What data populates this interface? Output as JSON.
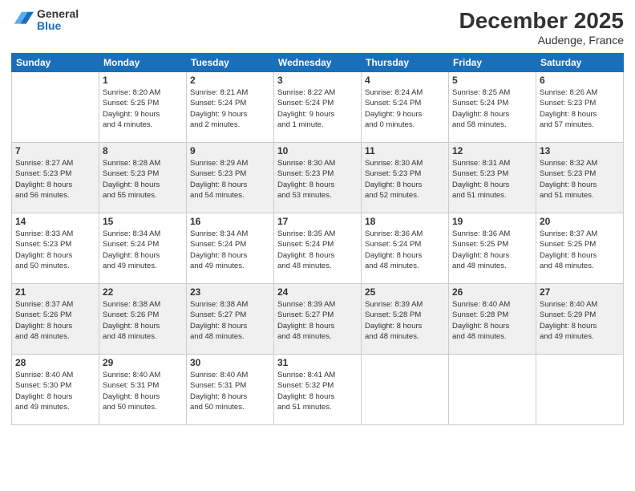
{
  "header": {
    "logo_general": "General",
    "logo_blue": "Blue",
    "month_title": "December 2025",
    "location": "Audenge, France"
  },
  "days_of_week": [
    "Sunday",
    "Monday",
    "Tuesday",
    "Wednesday",
    "Thursday",
    "Friday",
    "Saturday"
  ],
  "weeks": [
    [
      {
        "day": "",
        "info": ""
      },
      {
        "day": "1",
        "info": "Sunrise: 8:20 AM\nSunset: 5:25 PM\nDaylight: 9 hours\nand 4 minutes."
      },
      {
        "day": "2",
        "info": "Sunrise: 8:21 AM\nSunset: 5:24 PM\nDaylight: 9 hours\nand 2 minutes."
      },
      {
        "day": "3",
        "info": "Sunrise: 8:22 AM\nSunset: 5:24 PM\nDaylight: 9 hours\nand 1 minute."
      },
      {
        "day": "4",
        "info": "Sunrise: 8:24 AM\nSunset: 5:24 PM\nDaylight: 9 hours\nand 0 minutes."
      },
      {
        "day": "5",
        "info": "Sunrise: 8:25 AM\nSunset: 5:24 PM\nDaylight: 8 hours\nand 58 minutes."
      },
      {
        "day": "6",
        "info": "Sunrise: 8:26 AM\nSunset: 5:23 PM\nDaylight: 8 hours\nand 57 minutes."
      }
    ],
    [
      {
        "day": "7",
        "info": "Sunrise: 8:27 AM\nSunset: 5:23 PM\nDaylight: 8 hours\nand 56 minutes."
      },
      {
        "day": "8",
        "info": "Sunrise: 8:28 AM\nSunset: 5:23 PM\nDaylight: 8 hours\nand 55 minutes."
      },
      {
        "day": "9",
        "info": "Sunrise: 8:29 AM\nSunset: 5:23 PM\nDaylight: 8 hours\nand 54 minutes."
      },
      {
        "day": "10",
        "info": "Sunrise: 8:30 AM\nSunset: 5:23 PM\nDaylight: 8 hours\nand 53 minutes."
      },
      {
        "day": "11",
        "info": "Sunrise: 8:30 AM\nSunset: 5:23 PM\nDaylight: 8 hours\nand 52 minutes."
      },
      {
        "day": "12",
        "info": "Sunrise: 8:31 AM\nSunset: 5:23 PM\nDaylight: 8 hours\nand 51 minutes."
      },
      {
        "day": "13",
        "info": "Sunrise: 8:32 AM\nSunset: 5:23 PM\nDaylight: 8 hours\nand 51 minutes."
      }
    ],
    [
      {
        "day": "14",
        "info": "Sunrise: 8:33 AM\nSunset: 5:23 PM\nDaylight: 8 hours\nand 50 minutes."
      },
      {
        "day": "15",
        "info": "Sunrise: 8:34 AM\nSunset: 5:24 PM\nDaylight: 8 hours\nand 49 minutes."
      },
      {
        "day": "16",
        "info": "Sunrise: 8:34 AM\nSunset: 5:24 PM\nDaylight: 8 hours\nand 49 minutes."
      },
      {
        "day": "17",
        "info": "Sunrise: 8:35 AM\nSunset: 5:24 PM\nDaylight: 8 hours\nand 48 minutes."
      },
      {
        "day": "18",
        "info": "Sunrise: 8:36 AM\nSunset: 5:24 PM\nDaylight: 8 hours\nand 48 minutes."
      },
      {
        "day": "19",
        "info": "Sunrise: 8:36 AM\nSunset: 5:25 PM\nDaylight: 8 hours\nand 48 minutes."
      },
      {
        "day": "20",
        "info": "Sunrise: 8:37 AM\nSunset: 5:25 PM\nDaylight: 8 hours\nand 48 minutes."
      }
    ],
    [
      {
        "day": "21",
        "info": "Sunrise: 8:37 AM\nSunset: 5:26 PM\nDaylight: 8 hours\nand 48 minutes."
      },
      {
        "day": "22",
        "info": "Sunrise: 8:38 AM\nSunset: 5:26 PM\nDaylight: 8 hours\nand 48 minutes."
      },
      {
        "day": "23",
        "info": "Sunrise: 8:38 AM\nSunset: 5:27 PM\nDaylight: 8 hours\nand 48 minutes."
      },
      {
        "day": "24",
        "info": "Sunrise: 8:39 AM\nSunset: 5:27 PM\nDaylight: 8 hours\nand 48 minutes."
      },
      {
        "day": "25",
        "info": "Sunrise: 8:39 AM\nSunset: 5:28 PM\nDaylight: 8 hours\nand 48 minutes."
      },
      {
        "day": "26",
        "info": "Sunrise: 8:40 AM\nSunset: 5:28 PM\nDaylight: 8 hours\nand 48 minutes."
      },
      {
        "day": "27",
        "info": "Sunrise: 8:40 AM\nSunset: 5:29 PM\nDaylight: 8 hours\nand 49 minutes."
      }
    ],
    [
      {
        "day": "28",
        "info": "Sunrise: 8:40 AM\nSunset: 5:30 PM\nDaylight: 8 hours\nand 49 minutes."
      },
      {
        "day": "29",
        "info": "Sunrise: 8:40 AM\nSunset: 5:31 PM\nDaylight: 8 hours\nand 50 minutes."
      },
      {
        "day": "30",
        "info": "Sunrise: 8:40 AM\nSunset: 5:31 PM\nDaylight: 8 hours\nand 50 minutes."
      },
      {
        "day": "31",
        "info": "Sunrise: 8:41 AM\nSunset: 5:32 PM\nDaylight: 8 hours\nand 51 minutes."
      },
      {
        "day": "",
        "info": ""
      },
      {
        "day": "",
        "info": ""
      },
      {
        "day": "",
        "info": ""
      }
    ]
  ]
}
